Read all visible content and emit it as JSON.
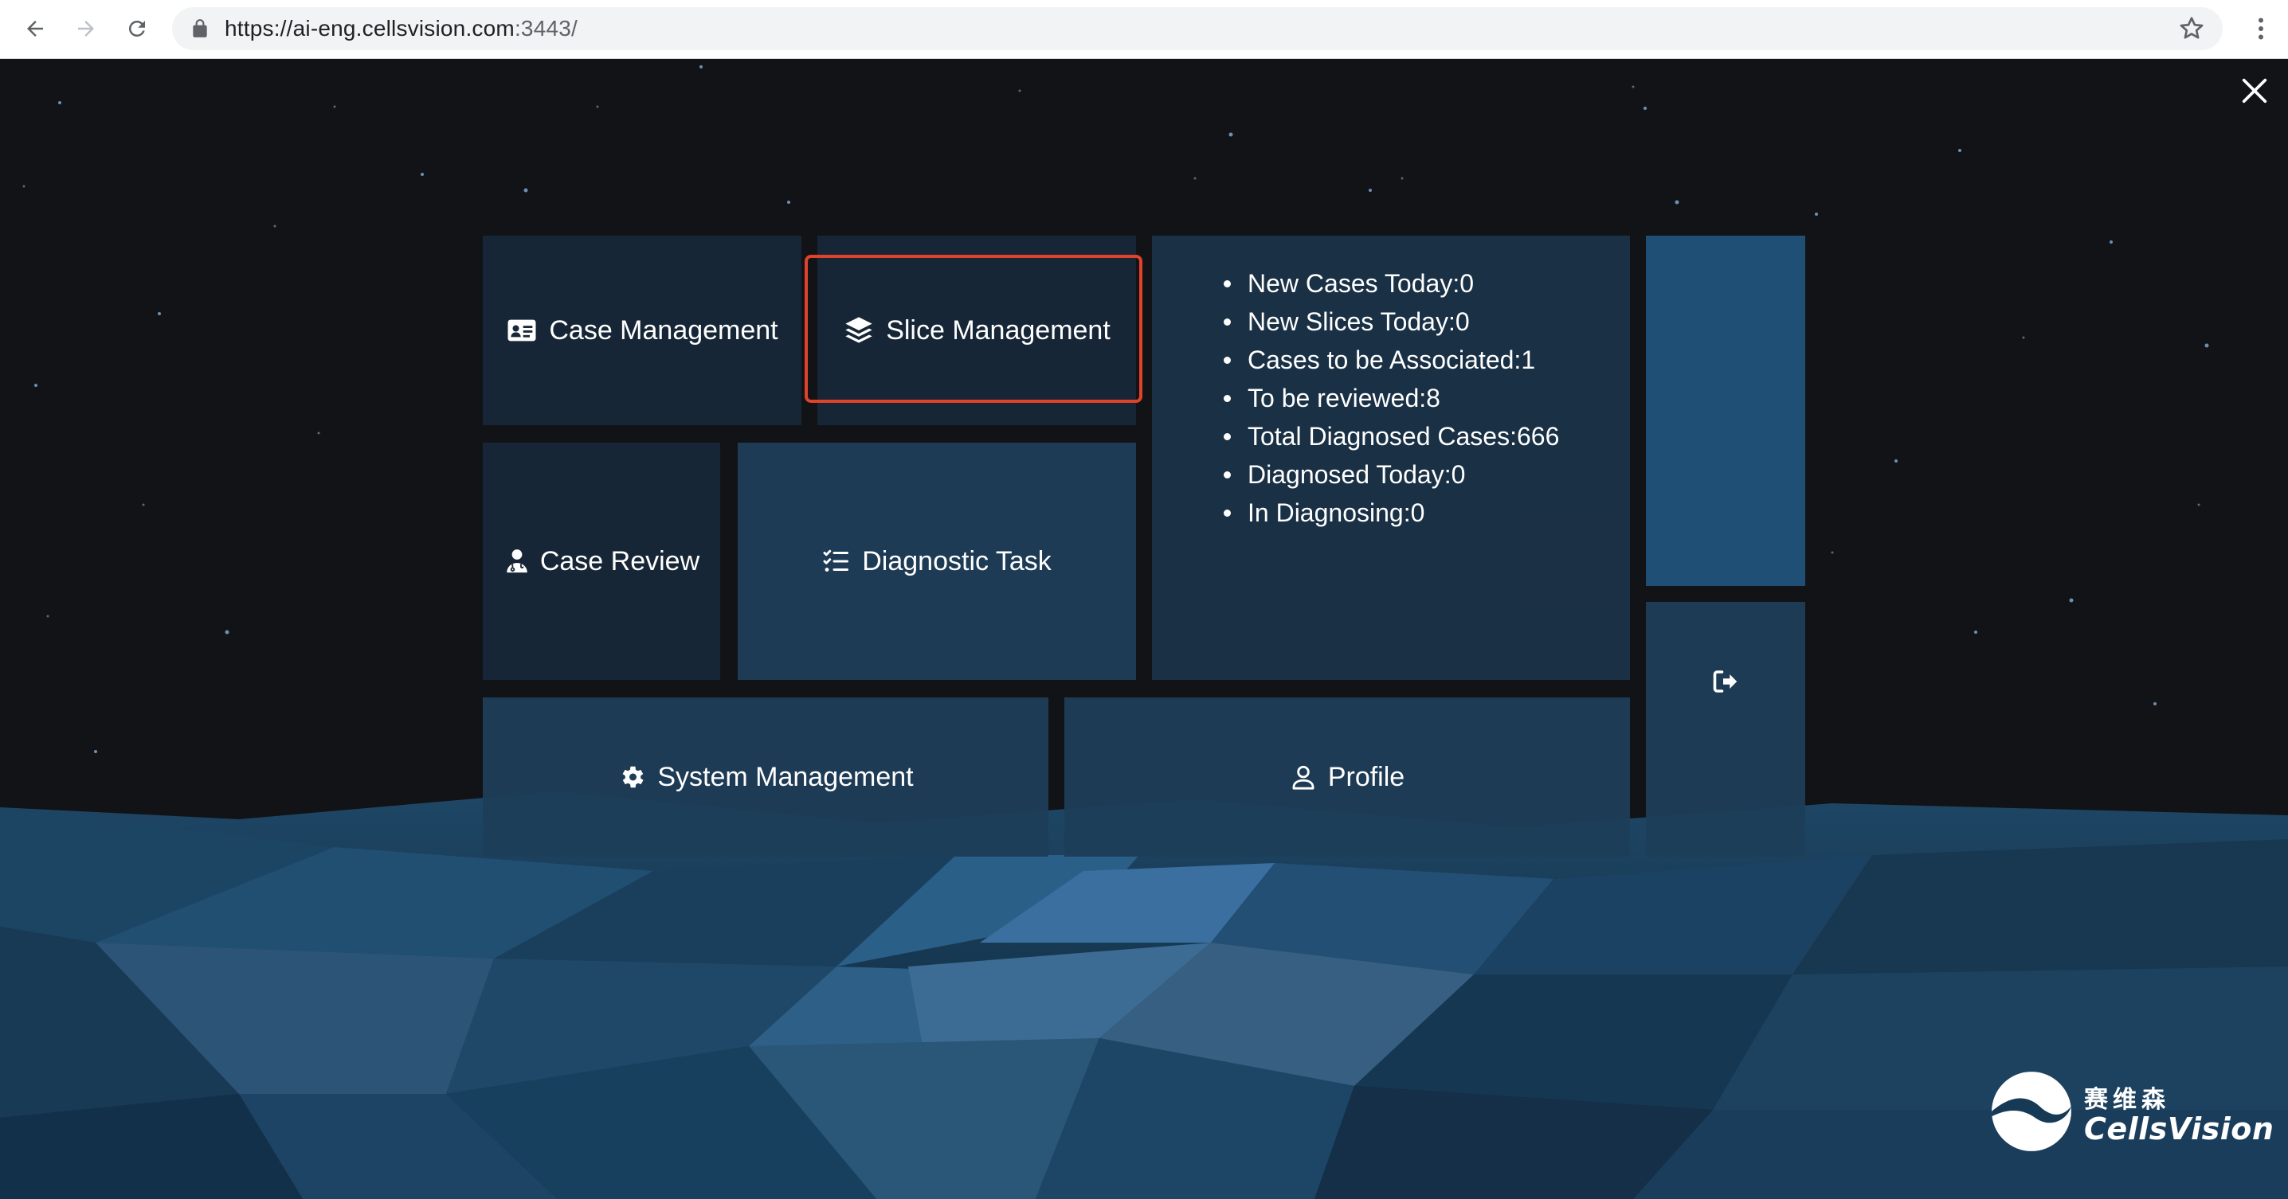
{
  "browser": {
    "url_host": "https://ai-eng.cellsvision.com",
    "url_port": ":3443/"
  },
  "menu": {
    "case_management": "Case Management",
    "slice_management": "Slice Management",
    "case_review": "Case Review",
    "diagnostic_task": "Diagnostic Task",
    "system_management": "System Management",
    "profile": "Profile"
  },
  "stats": [
    "New Cases Today:0",
    "New Slices Today:0",
    "Cases to be Associated:1",
    "To be reviewed:8",
    "Total Diagnosed Cases:666",
    "Diagnosed Today:0",
    "In Diagnosing:0"
  ],
  "logo": {
    "cn": "赛维森",
    "en": "CellsVision"
  },
  "colors": {
    "highlight": "#e0432a",
    "tile_dark": "#182838",
    "tile_blue": "#1f4f74"
  },
  "icons": {
    "back": "arrow-left-icon",
    "forward": "arrow-right-icon",
    "reload": "reload-icon",
    "lock": "lock-icon",
    "star": "star-icon",
    "menu": "kebab-menu-icon",
    "close": "close-icon",
    "case_management": "id-card-icon",
    "slice_management": "layers-icon",
    "case_review": "doctor-icon",
    "diagnostic_task": "task-list-icon",
    "system_management": "gear-icon",
    "profile": "user-icon",
    "logout": "sign-out-icon"
  }
}
